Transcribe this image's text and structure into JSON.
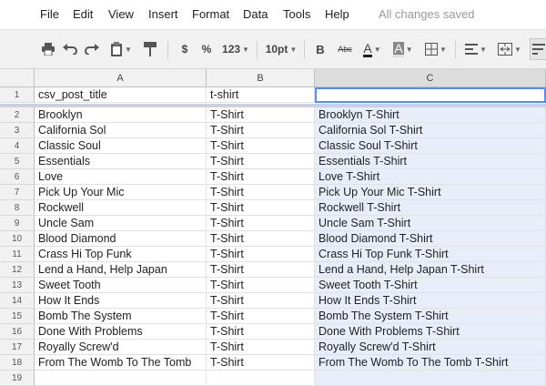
{
  "menu": {
    "items": [
      "File",
      "Edit",
      "View",
      "Insert",
      "Format",
      "Data",
      "Tools",
      "Help"
    ],
    "status": "All changes saved"
  },
  "toolbar": {
    "currency": "$",
    "percent": "%",
    "more_formats": "123",
    "font_size": "10pt",
    "bold": "B",
    "strikethrough": "Abc",
    "text_color": "A",
    "fill_color": "A"
  },
  "grid": {
    "columns": [
      "A",
      "B",
      "C"
    ],
    "header_row": {
      "num": "1",
      "a": "csv_post_title",
      "b": "t-shirt",
      "c": ""
    },
    "rows": [
      {
        "num": "2",
        "a": "Brooklyn",
        "b": "T-Shirt",
        "c": "Brooklyn T-Shirt"
      },
      {
        "num": "3",
        "a": "California Sol",
        "b": "T-Shirt",
        "c": "California Sol T-Shirt"
      },
      {
        "num": "4",
        "a": "Classic Soul",
        "b": "T-Shirt",
        "c": "Classic Soul T-Shirt"
      },
      {
        "num": "5",
        "a": "Essentials",
        "b": "T-Shirt",
        "c": "Essentials T-Shirt"
      },
      {
        "num": "6",
        "a": "Love",
        "b": "T-Shirt",
        "c": "Love T-Shirt"
      },
      {
        "num": "7",
        "a": "Pick Up Your Mic",
        "b": "T-Shirt",
        "c": "Pick Up Your Mic T-Shirt"
      },
      {
        "num": "8",
        "a": "Rockwell",
        "b": "T-Shirt",
        "c": "Rockwell T-Shirt"
      },
      {
        "num": "9",
        "a": "Uncle Sam",
        "b": "T-Shirt",
        "c": "Uncle Sam T-Shirt"
      },
      {
        "num": "10",
        "a": "Blood Diamond",
        "b": "T-Shirt",
        "c": "Blood Diamond T-Shirt"
      },
      {
        "num": "11",
        "a": "Crass Hi Top Funk",
        "b": "T-Shirt",
        "c": "Crass Hi Top Funk T-Shirt"
      },
      {
        "num": "12",
        "a": "Lend a Hand, Help Japan",
        "b": "T-Shirt",
        "c": "Lend a Hand, Help Japan T-Shirt"
      },
      {
        "num": "13",
        "a": "Sweet Tooth",
        "b": "T-Shirt",
        "c": "Sweet Tooth T-Shirt"
      },
      {
        "num": "14",
        "a": "How It Ends",
        "b": "T-Shirt",
        "c": "How It Ends T-Shirt"
      },
      {
        "num": "15",
        "a": "Bomb The System",
        "b": "T-Shirt",
        "c": "Bomb The System T-Shirt"
      },
      {
        "num": "16",
        "a": "Done With Problems",
        "b": "T-Shirt",
        "c": "Done With Problems T-Shirt"
      },
      {
        "num": "17",
        "a": "Royally Screw'd",
        "b": "T-Shirt",
        "c": "Royally Screw'd T-Shirt"
      },
      {
        "num": "18",
        "a": "From The Womb To The Tomb",
        "b": "T-Shirt",
        "c": "From The Womb To The Tomb T-Shirt"
      },
      {
        "num": "19",
        "a": "",
        "b": "",
        "c": ""
      }
    ]
  },
  "colors": {
    "selection_fill": "#e8eef9",
    "active_border": "#4d90fe"
  }
}
